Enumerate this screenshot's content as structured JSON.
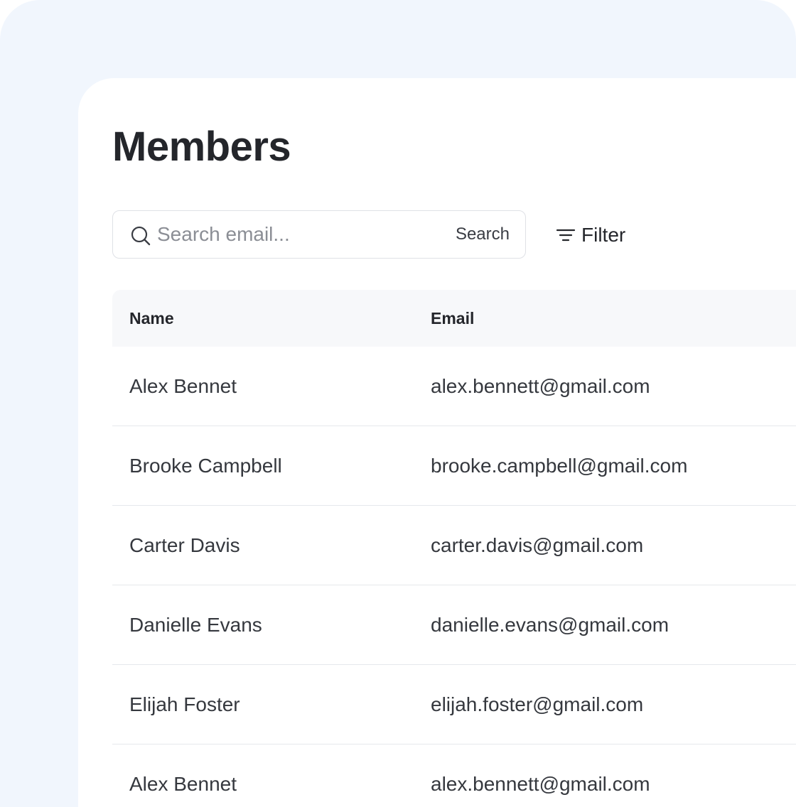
{
  "page": {
    "title": "Members"
  },
  "search": {
    "placeholder": "Search email...",
    "value": "",
    "button_label": "Search"
  },
  "filter": {
    "label": "Filter"
  },
  "table": {
    "columns": [
      "Name",
      "Email"
    ],
    "rows": [
      {
        "name": "Alex Bennet",
        "email": "alex.bennett@gmail.com"
      },
      {
        "name": "Brooke Campbell",
        "email": "brooke.campbell@gmail.com"
      },
      {
        "name": "Carter Davis",
        "email": "carter.davis@gmail.com"
      },
      {
        "name": "Danielle Evans",
        "email": "danielle.evans@gmail.com"
      },
      {
        "name": "Elijah Foster",
        "email": "elijah.foster@gmail.com"
      },
      {
        "name": "Alex Bennet",
        "email": "alex.bennett@gmail.com"
      }
    ]
  },
  "icons": {
    "search": "search-icon",
    "filter": "filter-icon"
  },
  "colors": {
    "backdrop": "#f1f6fd",
    "panel": "#ffffff",
    "header_row": "#f7f8fa",
    "text": "#24262b",
    "divider": "#e6e8ec"
  }
}
